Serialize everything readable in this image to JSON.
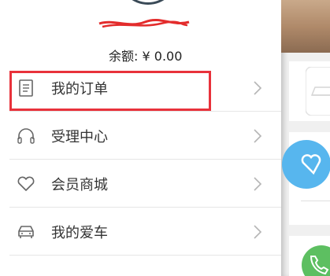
{
  "user": {
    "balance_label": "余额:",
    "balance_value": "¥ 0.00"
  },
  "menu": {
    "items": [
      {
        "label": "我的订单",
        "icon": "document-icon"
      },
      {
        "label": "受理中心",
        "icon": "headphones-icon"
      },
      {
        "label": "会员商城",
        "icon": "heart-icon"
      },
      {
        "label": "我的爱车",
        "icon": "car-icon"
      }
    ]
  },
  "colors": {
    "highlight": "#e8323b",
    "divider": "#e6e6e6",
    "accent_blue": "#57b6ee",
    "accent_green": "#5dbf61"
  }
}
